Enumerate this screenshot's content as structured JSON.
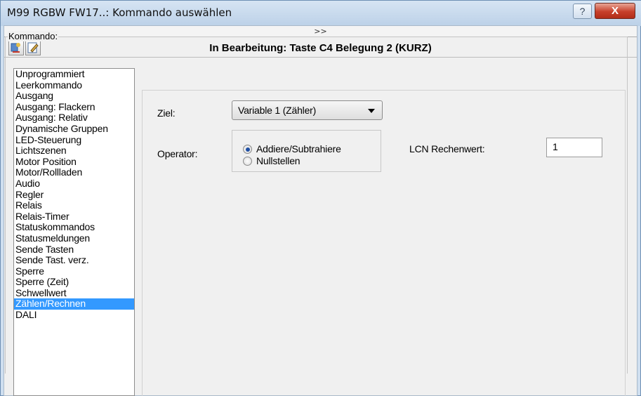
{
  "window": {
    "title": "M99 RGBW FW17..: Kommando auswählen",
    "help_label": "?",
    "close_label": "X"
  },
  "expand": {
    "label": ">>"
  },
  "toolbar": {
    "buttons": [
      {
        "icon": "wizard-icon"
      },
      {
        "icon": "edit-icon"
      }
    ]
  },
  "editing_title": "In Bearbeitung: Taste C4 Belegung 2 (KURZ)",
  "kommando_group": {
    "label": "Kommando:"
  },
  "commands": [
    "Unprogrammiert",
    "Leerkommando",
    "Ausgang",
    "Ausgang: Flackern",
    "Ausgang: Relativ",
    "Dynamische Gruppen",
    "LED-Steuerung",
    "Lichtszenen",
    "Motor Position",
    "Motor/Rollladen",
    "Audio",
    "Regler",
    "Relais",
    "Relais-Timer",
    "Statuskommandos",
    "Statusmeldungen",
    "Sende Tasten",
    "Sende Tast. verz.",
    "Sperre",
    "Sperre (Zeit)",
    "Schwellwert",
    "Zählen/Rechnen",
    "DALI"
  ],
  "selected_command_index": 21,
  "form": {
    "ziel_label": "Ziel:",
    "ziel_value": "Variable 1 (Zähler)",
    "operator_label": "Operator:",
    "operator_options": [
      "Addiere/Subtrahiere",
      "Nullstellen"
    ],
    "operator_selected_index": 0,
    "lcn_label": "LCN Rechenwert:",
    "lcn_value": "1"
  },
  "colors": {
    "selection": "#3399ff",
    "close_button": "#c7402b",
    "titlebar": "#cfdff0"
  }
}
